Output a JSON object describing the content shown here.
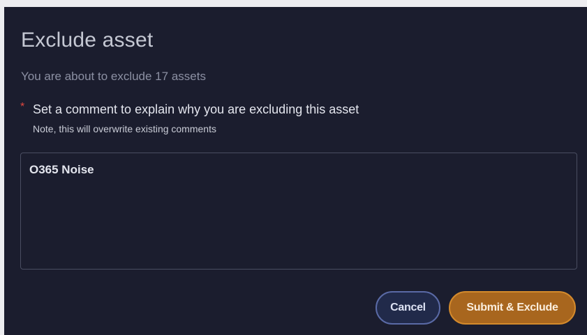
{
  "dialog": {
    "title": "Exclude asset",
    "subtitle": "You are about to exclude 17 assets",
    "required_marker": "*",
    "comment_label": "Set a comment to explain why you are excluding this asset",
    "comment_note": "Note, this will overwrite existing comments",
    "comment_value": "O365 Noise",
    "cancel_label": "Cancel",
    "submit_label": "Submit & Exclude"
  },
  "colors": {
    "background": "#1b1d2e",
    "accent": "#a8661e",
    "required": "#e0473f"
  }
}
